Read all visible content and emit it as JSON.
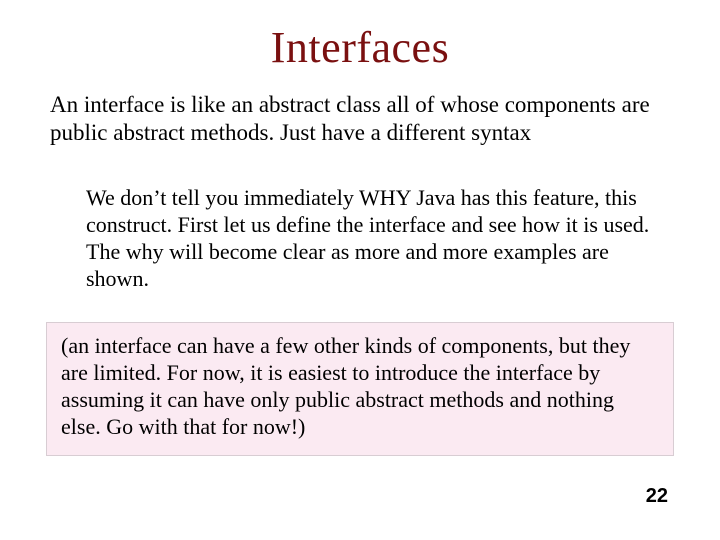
{
  "title": "Interfaces",
  "lead": "An interface is like an abstract class all of whose components are public abstract methods. Just have a different syntax",
  "explain": "We don’t tell you immediately WHY Java has this feature, this construct. First let us define the interface and see how it is used. The why will become clear as more and more examples are shown.",
  "note": "(an interface can have a few other kinds of components, but they are limited. For now, it is easiest to introduce the interface by assuming it can have only public abstract methods and nothing else. Go with that for now!)",
  "page_number": "22"
}
